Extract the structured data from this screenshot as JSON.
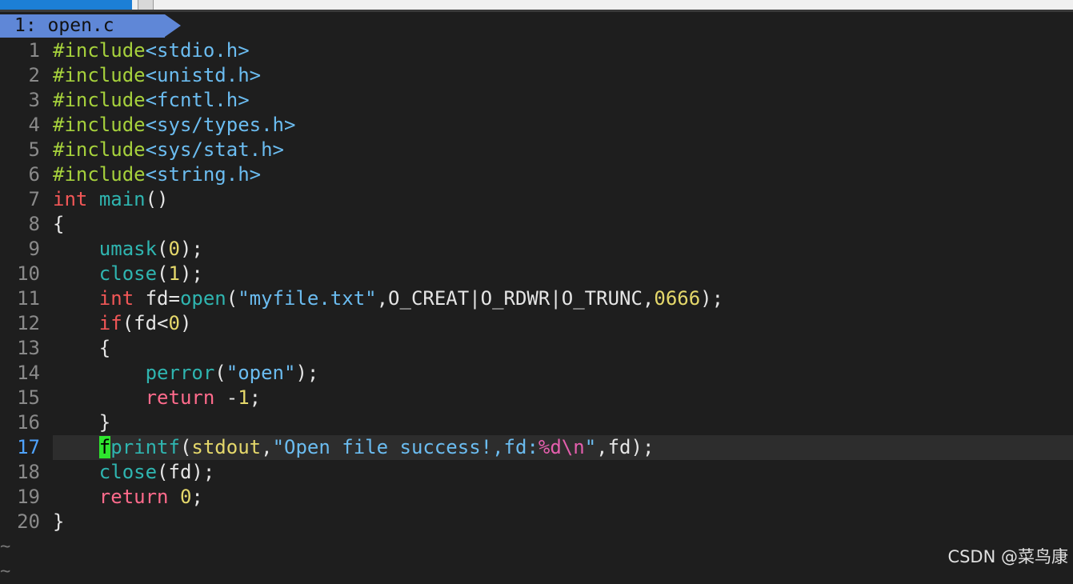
{
  "window": {
    "top_tab_label": "",
    "buffer_tab_label": "1: open.c"
  },
  "editor": {
    "current_line": 17,
    "lines": [
      {
        "num": "1",
        "tokens": [
          {
            "t": "#include",
            "c": "preproc"
          },
          {
            "t": "<stdio.h>",
            "c": "header"
          }
        ]
      },
      {
        "num": "2",
        "tokens": [
          {
            "t": "#include",
            "c": "preproc"
          },
          {
            "t": "<unistd.h>",
            "c": "header"
          }
        ]
      },
      {
        "num": "3",
        "tokens": [
          {
            "t": "#include",
            "c": "preproc"
          },
          {
            "t": "<fcntl.h>",
            "c": "header"
          }
        ]
      },
      {
        "num": "4",
        "tokens": [
          {
            "t": "#include",
            "c": "preproc"
          },
          {
            "t": "<sys/types.h>",
            "c": "header"
          }
        ]
      },
      {
        "num": "5",
        "tokens": [
          {
            "t": "#include",
            "c": "preproc"
          },
          {
            "t": "<sys/stat.h>",
            "c": "header"
          }
        ]
      },
      {
        "num": "6",
        "tokens": [
          {
            "t": "#include",
            "c": "preproc"
          },
          {
            "t": "<string.h>",
            "c": "header"
          }
        ]
      },
      {
        "num": "7",
        "tokens": [
          {
            "t": "int",
            "c": "type"
          },
          {
            "t": " ",
            "c": "normal"
          },
          {
            "t": "main",
            "c": "func"
          },
          {
            "t": "()",
            "c": "normal"
          }
        ]
      },
      {
        "num": "8",
        "tokens": [
          {
            "t": "{",
            "c": "normal"
          }
        ]
      },
      {
        "num": "9",
        "tokens": [
          {
            "t": "    ",
            "c": "normal"
          },
          {
            "t": "umask",
            "c": "func"
          },
          {
            "t": "(",
            "c": "normal"
          },
          {
            "t": "0",
            "c": "number"
          },
          {
            "t": ");",
            "c": "normal"
          }
        ]
      },
      {
        "num": "10",
        "tokens": [
          {
            "t": "    ",
            "c": "normal"
          },
          {
            "t": "close",
            "c": "func"
          },
          {
            "t": "(",
            "c": "normal"
          },
          {
            "t": "1",
            "c": "number"
          },
          {
            "t": ");",
            "c": "normal"
          }
        ]
      },
      {
        "num": "11",
        "tokens": [
          {
            "t": "    ",
            "c": "normal"
          },
          {
            "t": "int",
            "c": "type"
          },
          {
            "t": " fd=",
            "c": "normal"
          },
          {
            "t": "open",
            "c": "func"
          },
          {
            "t": "(",
            "c": "normal"
          },
          {
            "t": "\"myfile.txt\"",
            "c": "string"
          },
          {
            "t": ",O_CREAT|O_RDWR|O_TRUNC,",
            "c": "normal"
          },
          {
            "t": "0666",
            "c": "number"
          },
          {
            "t": ");",
            "c": "normal"
          }
        ]
      },
      {
        "num": "12",
        "tokens": [
          {
            "t": "    ",
            "c": "normal"
          },
          {
            "t": "if",
            "c": "keyword"
          },
          {
            "t": "(fd<",
            "c": "normal"
          },
          {
            "t": "0",
            "c": "number"
          },
          {
            "t": ")",
            "c": "normal"
          }
        ]
      },
      {
        "num": "13",
        "tokens": [
          {
            "t": "    {",
            "c": "normal"
          }
        ]
      },
      {
        "num": "14",
        "tokens": [
          {
            "t": "        ",
            "c": "normal"
          },
          {
            "t": "perror",
            "c": "func"
          },
          {
            "t": "(",
            "c": "normal"
          },
          {
            "t": "\"open\"",
            "c": "string"
          },
          {
            "t": ");",
            "c": "normal"
          }
        ]
      },
      {
        "num": "15",
        "tokens": [
          {
            "t": "        ",
            "c": "normal"
          },
          {
            "t": "return",
            "c": "ret"
          },
          {
            "t": " -",
            "c": "normal"
          },
          {
            "t": "1",
            "c": "number"
          },
          {
            "t": ";",
            "c": "normal"
          }
        ]
      },
      {
        "num": "16",
        "tokens": [
          {
            "t": "    }",
            "c": "normal"
          }
        ]
      },
      {
        "num": "17",
        "tokens": [
          {
            "t": "    ",
            "c": "normal"
          },
          {
            "t": "f",
            "c": "cursor"
          },
          {
            "t": "printf",
            "c": "func"
          },
          {
            "t": "(",
            "c": "normal"
          },
          {
            "t": "stdout",
            "c": "number"
          },
          {
            "t": ",",
            "c": "normal"
          },
          {
            "t": "\"Open file success!,fd:",
            "c": "string"
          },
          {
            "t": "%d\\n",
            "c": "escape"
          },
          {
            "t": "\"",
            "c": "string"
          },
          {
            "t": ",fd);",
            "c": "normal"
          }
        ]
      },
      {
        "num": "18",
        "tokens": [
          {
            "t": "    ",
            "c": "normal"
          },
          {
            "t": "close",
            "c": "func"
          },
          {
            "t": "(fd);",
            "c": "normal"
          }
        ]
      },
      {
        "num": "19",
        "tokens": [
          {
            "t": "    ",
            "c": "normal"
          },
          {
            "t": "return",
            "c": "ret"
          },
          {
            "t": " ",
            "c": "normal"
          },
          {
            "t": "0",
            "c": "number"
          },
          {
            "t": ";",
            "c": "normal"
          }
        ]
      },
      {
        "num": "20",
        "tokens": [
          {
            "t": "}",
            "c": "normal"
          }
        ]
      }
    ],
    "empty_line_marker": "~"
  },
  "watermark": "CSDN @菜鸟康",
  "colors": {
    "background": "#1e1e1e",
    "tab_blue": "#5f87d7",
    "preproc": "#a6d13c",
    "string": "#6bbcf0",
    "type": "#f25757",
    "func": "#2fb5b0",
    "number": "#e5d86b",
    "cursor": "#2ee62e"
  }
}
